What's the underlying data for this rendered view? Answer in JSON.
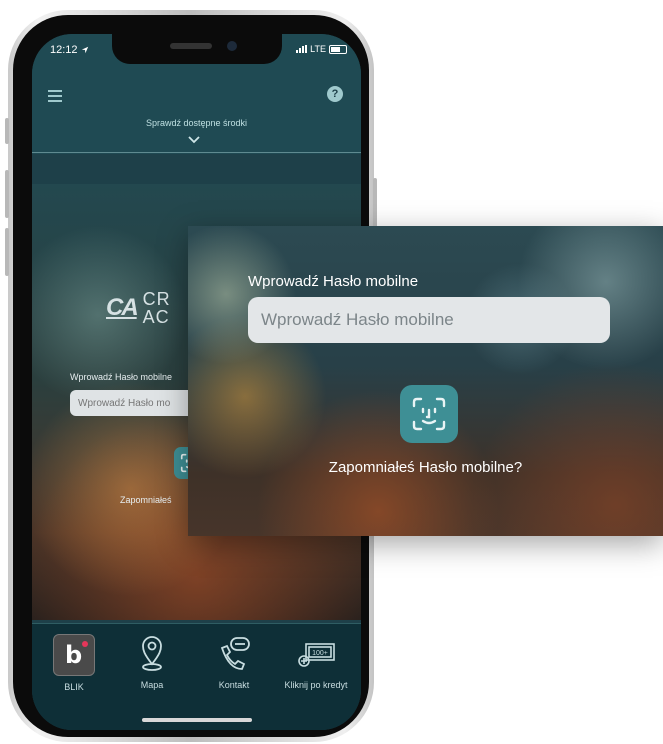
{
  "status_bar": {
    "time": "12:12",
    "network": "LTE"
  },
  "header": {
    "check_funds": "Sprawdź dostępne środki"
  },
  "logo": {
    "mark": "CA",
    "line1": "CR",
    "line2": "AC"
  },
  "login": {
    "label": "Wprowadź Hasło mobilne",
    "placeholder": "Wprowadź Hasło mobilne",
    "faceid_icon": "face-id-icon",
    "forgot": "Zapomniałeś Hasło mobilne?"
  },
  "inner_login": {
    "label": "Wprowadź Hasło mobilne",
    "placeholder": "Wprowadź Hasło mo",
    "forgot": "Zapomniałeś"
  },
  "tabbar": {
    "items": [
      {
        "label": "BLIK",
        "icon": "blik-icon"
      },
      {
        "label": "Mapa",
        "icon": "map-pin-icon"
      },
      {
        "label": "Kontakt",
        "icon": "phone-chat-icon"
      },
      {
        "label": "Kliknij po kredyt",
        "icon": "credit-icon"
      }
    ],
    "credit_badge": "100+"
  },
  "colors": {
    "accent": "#3e8f95",
    "screen_bg": "#1e4049",
    "tabbar_bg": "#0e2f37"
  }
}
